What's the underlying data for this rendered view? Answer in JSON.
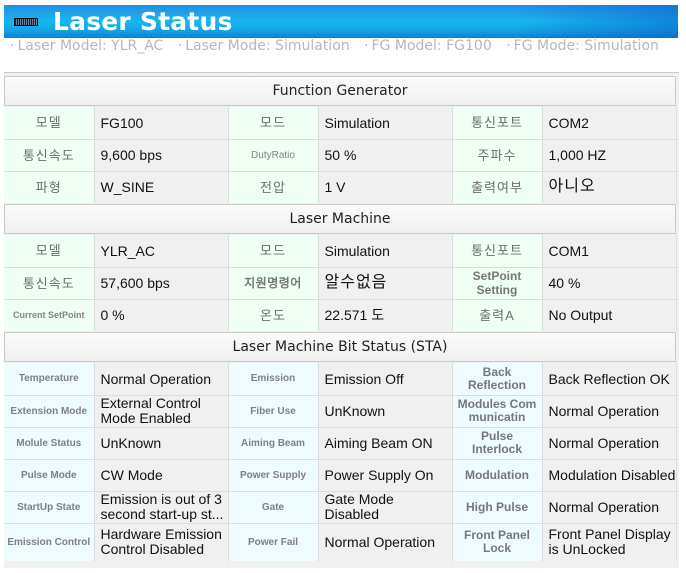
{
  "window": {
    "title": "Laser Status",
    "title_icon": "status-bar-icon"
  },
  "infobar": {
    "items": [
      "Laser Model: YLR_AC",
      "Laser Mode: Simulation",
      "FG Model: FG100",
      "FG Mode: Simulation"
    ],
    "bullet": "·"
  },
  "colors": {
    "title_gradient": [
      "#1f8fe0",
      "#15b8ef",
      "#0d7fd1"
    ],
    "label_green": "#effff4",
    "label_blue": "#eefbff",
    "value_bg": "#f0f0f0",
    "info_text": "#b7b7b7"
  },
  "function_generator": {
    "header": "Function Generator",
    "rows": [
      [
        {
          "label": "모델",
          "value": "FG100"
        },
        {
          "label": "모드",
          "value": "Simulation"
        },
        {
          "label": "통신포트",
          "value": "COM2"
        }
      ],
      [
        {
          "label": "통신속도",
          "value": "9,600 bps"
        },
        {
          "label": "DutyRatio",
          "value": "50 %"
        },
        {
          "label": "주파수",
          "value": "1,000 HZ"
        }
      ],
      [
        {
          "label": "파형",
          "value": "W_SINE"
        },
        {
          "label": "전압",
          "value": "1 V"
        },
        {
          "label": "출력여부",
          "value": "아니오"
        }
      ]
    ]
  },
  "laser_machine": {
    "header": "Laser Machine",
    "rows": [
      [
        {
          "label": "모델",
          "value": "YLR_AC"
        },
        {
          "label": "모드",
          "value": "Simulation"
        },
        {
          "label": "통신포트",
          "value": "COM1"
        }
      ],
      [
        {
          "label": "통신속도",
          "value": "57,600 bps"
        },
        {
          "label": "지원명령어",
          "value": "알수없음"
        },
        {
          "label": "SetPoint Setting",
          "value": "40 %"
        }
      ],
      [
        {
          "label": "Current SetPoint",
          "value": "0 %"
        },
        {
          "label": "온도",
          "value": "22.571 도"
        },
        {
          "label": "출력A",
          "value": "No Output"
        }
      ]
    ]
  },
  "bit_status": {
    "header": "Laser Machine Bit Status (STA)",
    "rows": [
      [
        {
          "label": "Temperature",
          "value": "Normal Operation"
        },
        {
          "label": "Emission",
          "value": "Emission Off"
        },
        {
          "label": "Back Reflection",
          "value": "Back Reflection OK"
        }
      ],
      [
        {
          "label": "Extension Mode",
          "value": "External Control Mode Enabled"
        },
        {
          "label": "Fiber Use",
          "value": "UnKnown"
        },
        {
          "label": "Modules Communicatin",
          "value": "Normal Operation"
        }
      ],
      [
        {
          "label": "Molule Status",
          "value": "UnKnown"
        },
        {
          "label": "Aiming Beam",
          "value": "Aiming Beam ON"
        },
        {
          "label": "Pulse Interlock",
          "value": "Normal Operation"
        }
      ],
      [
        {
          "label": "Pulse Mode",
          "value": "CW Mode"
        },
        {
          "label": "Power Supply",
          "value": "Power Supply On"
        },
        {
          "label": "Modulation",
          "value": "Modulation Disabled"
        }
      ],
      [
        {
          "label": "StartUp State",
          "value": "Emission is out of 3 second start-up st..."
        },
        {
          "label": "Gate",
          "value": "Gate Mode Disabled"
        },
        {
          "label": "High Pulse",
          "value": "Normal Operation"
        }
      ],
      [
        {
          "label": "Emission Control",
          "value": "Hardware Emission Control Disabled"
        },
        {
          "label": "Power Fail",
          "value": "Normal Operation"
        },
        {
          "label": "Front Panel Lock",
          "value": "Front Panel Display is UnLocked"
        }
      ]
    ]
  }
}
